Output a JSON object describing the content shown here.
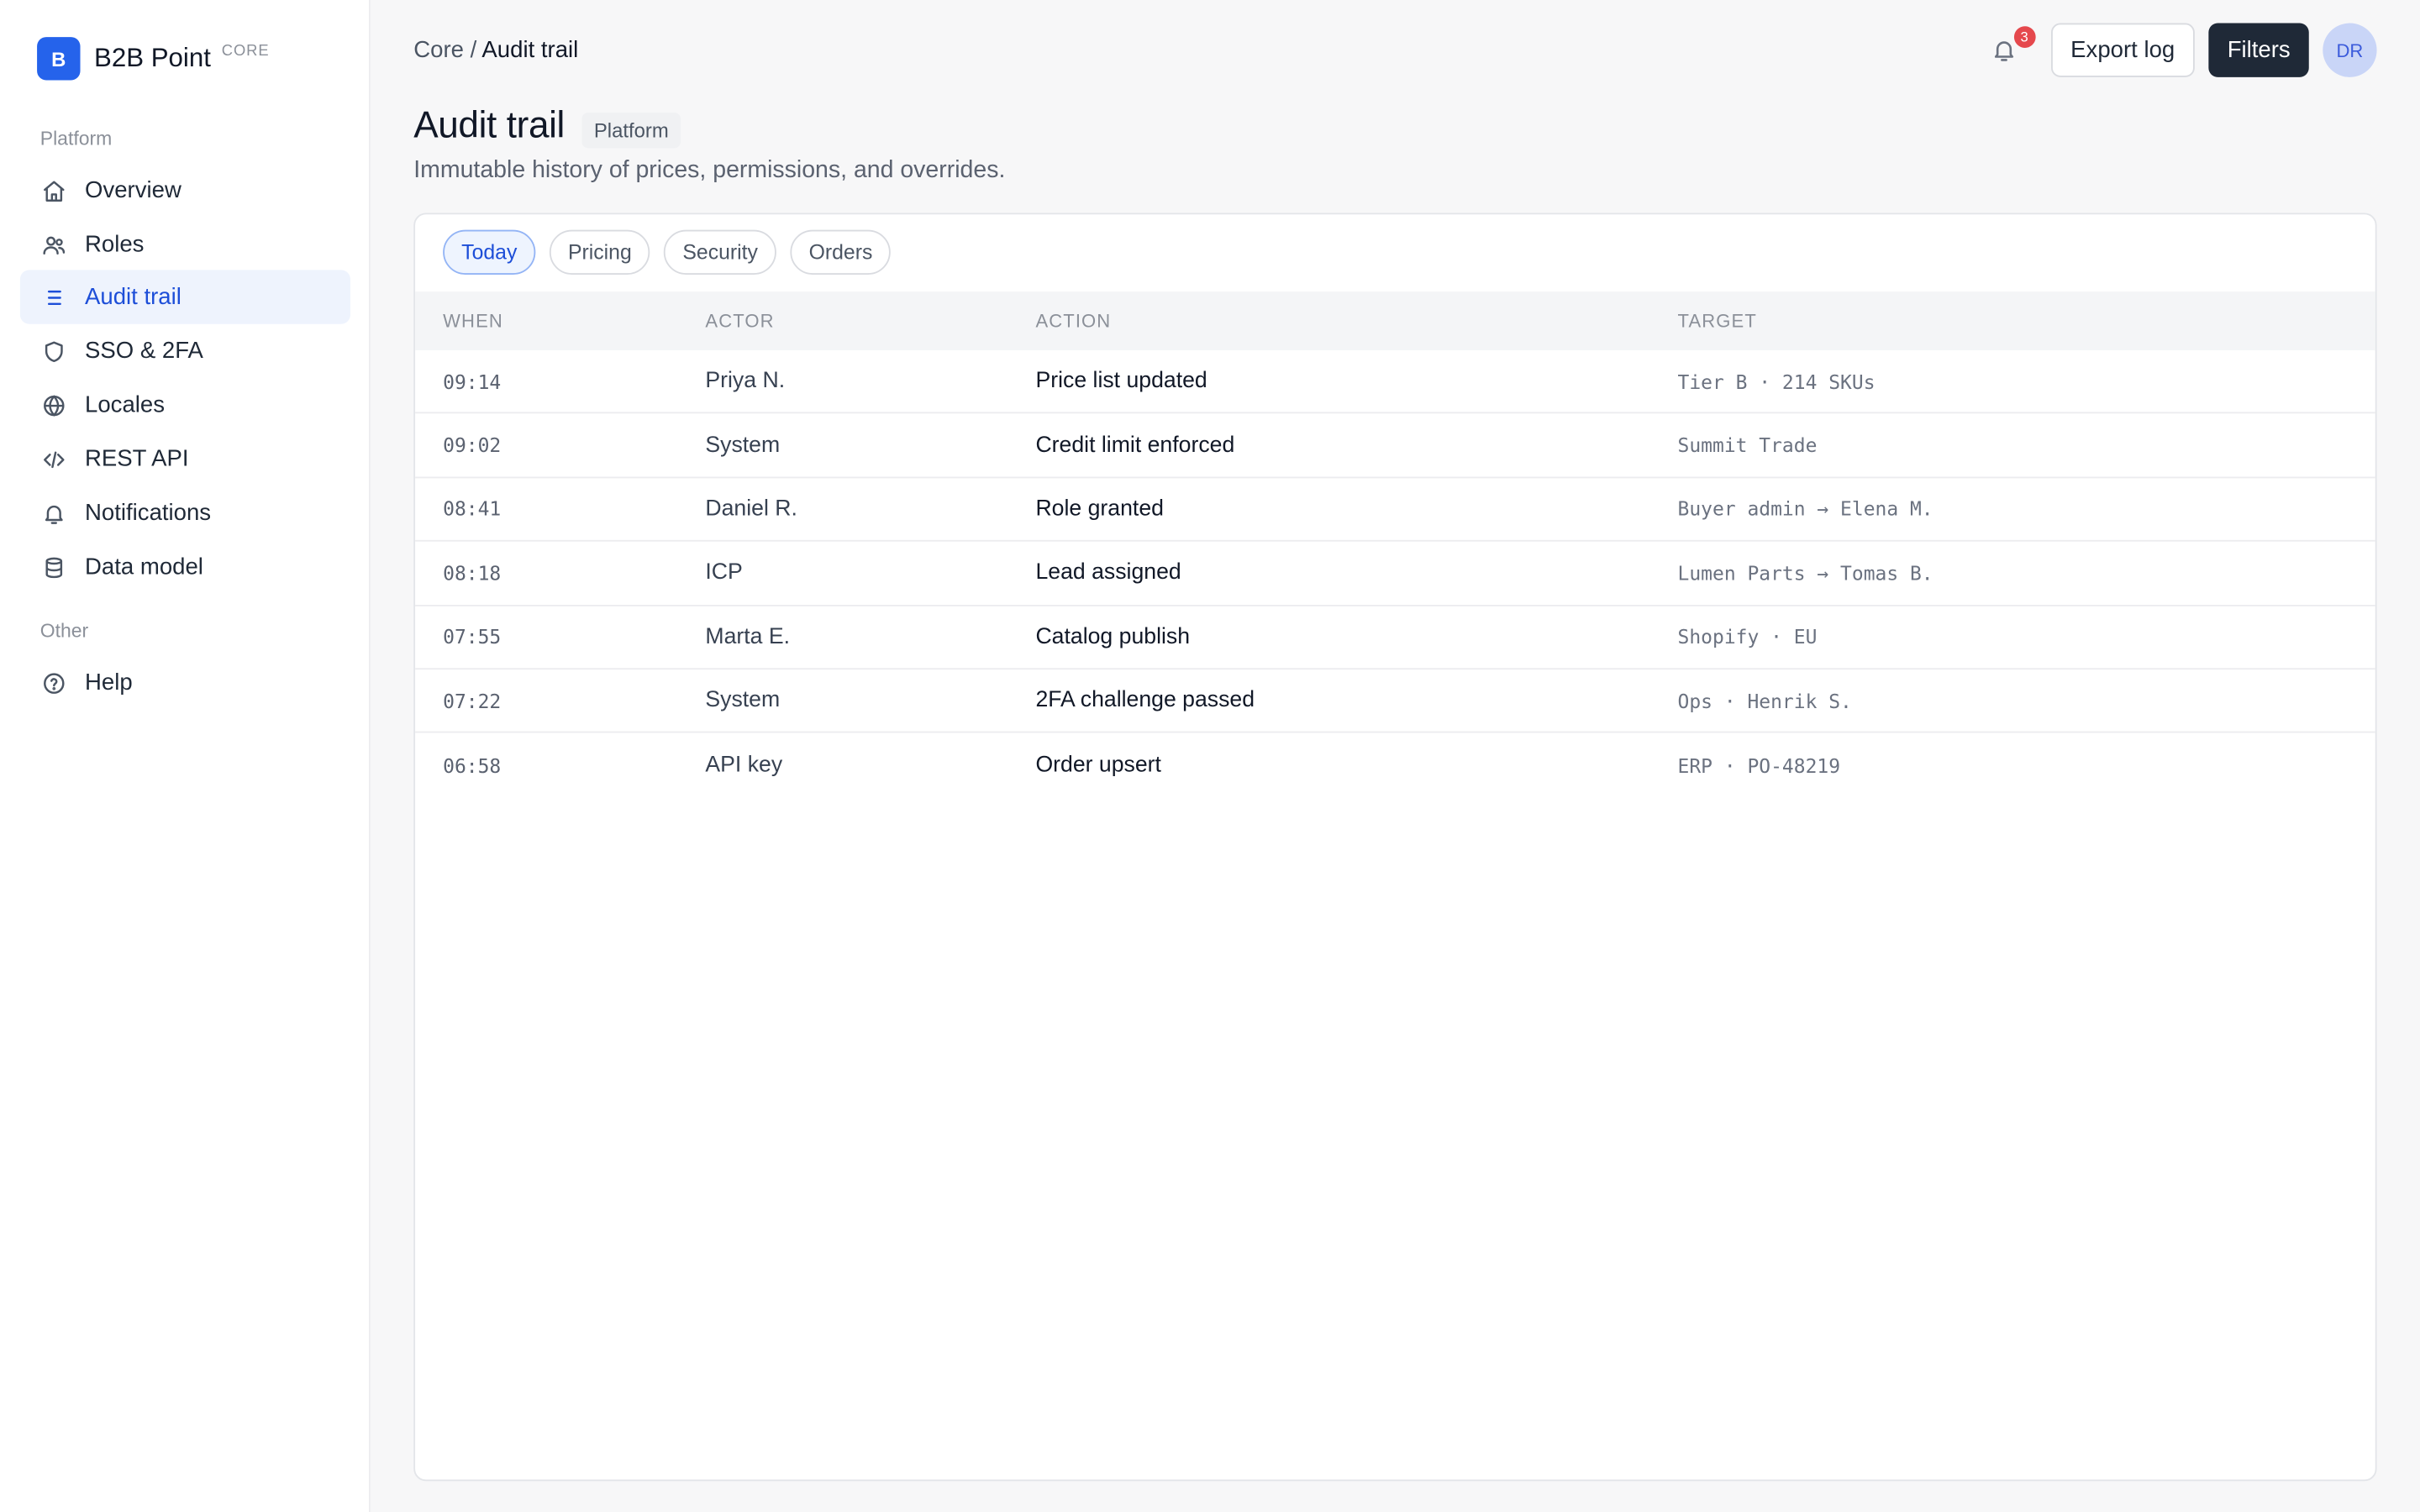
{
  "brand": {
    "logo_letter": "B",
    "name": "B2B Point",
    "tag": "CORE",
    "logo_color": "#2563eb"
  },
  "sidebar": {
    "sections": [
      {
        "label": "Platform"
      },
      {
        "label": "Other"
      }
    ],
    "items": [
      {
        "label": "Overview",
        "icon": "home-icon"
      },
      {
        "label": "Roles",
        "icon": "users-icon"
      },
      {
        "label": "Audit trail",
        "icon": "list-icon",
        "active": true
      },
      {
        "label": "SSO & 2FA",
        "icon": "shield-icon"
      },
      {
        "label": "Locales",
        "icon": "globe-icon"
      },
      {
        "label": "REST API",
        "icon": "code-icon"
      },
      {
        "label": "Notifications",
        "icon": "bell-icon"
      },
      {
        "label": "Data model",
        "icon": "database-icon"
      },
      {
        "label": "Help",
        "icon": "help-circle-icon"
      }
    ]
  },
  "header": {
    "breadcrumb_root": "Core",
    "breadcrumb_sep": "/",
    "breadcrumb_current": "Audit trail",
    "notification_count": "3",
    "export_label": "Export log",
    "filters_label": "Filters",
    "avatar_initials": "DR"
  },
  "page": {
    "title": "Audit trail",
    "badge": "Platform",
    "subtitle": "Immutable history of prices, permissions, and overrides."
  },
  "filters": {
    "chips": [
      {
        "label": "Today",
        "active": true
      },
      {
        "label": "Pricing"
      },
      {
        "label": "Security"
      },
      {
        "label": "Orders"
      }
    ]
  },
  "table": {
    "columns": [
      "WHEN",
      "ACTOR",
      "ACTION",
      "TARGET"
    ],
    "rows": [
      {
        "when": "09:14",
        "actor": "Priya N.",
        "action": "Price list updated",
        "target": "Tier B · 214 SKUs"
      },
      {
        "when": "09:02",
        "actor": "System",
        "action": "Credit limit enforced",
        "target": "Summit Trade"
      },
      {
        "when": "08:41",
        "actor": "Daniel R.",
        "action": "Role granted",
        "target": "Buyer admin → Elena M."
      },
      {
        "when": "08:18",
        "actor": "ICP",
        "action": "Lead assigned",
        "target": "Lumen Parts → Tomas B."
      },
      {
        "when": "07:55",
        "actor": "Marta E.",
        "action": "Catalog publish",
        "target": "Shopify · EU"
      },
      {
        "when": "07:22",
        "actor": "System",
        "action": "2FA challenge passed",
        "target": "Ops · Henrik S."
      },
      {
        "when": "06:58",
        "actor": "API key",
        "action": "Order upsert",
        "target": "ERP · PO-48219"
      }
    ]
  },
  "colors": {
    "accent": "#1d4ed8",
    "active_nav_bg": "#eef3fd",
    "primary_button": "#1f2937",
    "badge_red": "#e5484d"
  }
}
